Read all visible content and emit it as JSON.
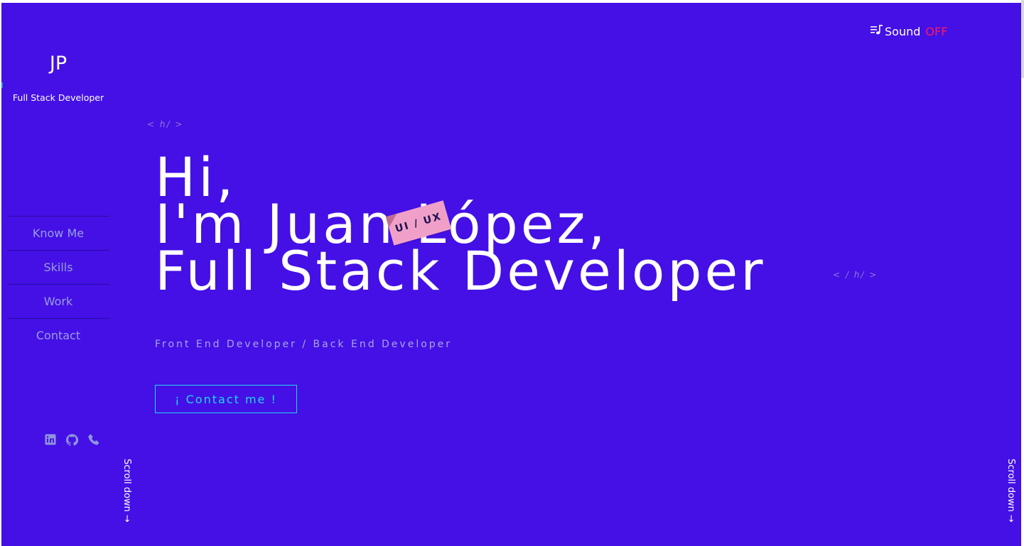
{
  "brand": {
    "initials": "JP",
    "role": "Full Stack Developer"
  },
  "nav": {
    "items": [
      {
        "label": "Know Me"
      },
      {
        "label": "Skills"
      },
      {
        "label": "Work"
      },
      {
        "label": "Contact"
      }
    ]
  },
  "socials": [
    {
      "icon": "linkedin-icon"
    },
    {
      "icon": "github-icon"
    },
    {
      "icon": "phone-icon"
    }
  ],
  "sound": {
    "label": "Sound",
    "state": "OFF",
    "icon": "playlist-music-icon",
    "state_color": "#ff1a5c"
  },
  "hero": {
    "tag_open": "< h/ >",
    "tag_close": "< / h/ >",
    "line1": "Hi,",
    "line2": "I'm Juan López,",
    "line3": "Full Stack Developer",
    "sticker": "UI / UX",
    "subtitle": "Front End Developer / Back End Developer",
    "cta": "¡ Contact me !"
  },
  "scroll": {
    "label": "Scroll down →"
  },
  "colors": {
    "background": "#4410e6",
    "accent": "#22d6f0",
    "sticker": "#f0a0c8",
    "nav_text": "#9a9ee0"
  }
}
